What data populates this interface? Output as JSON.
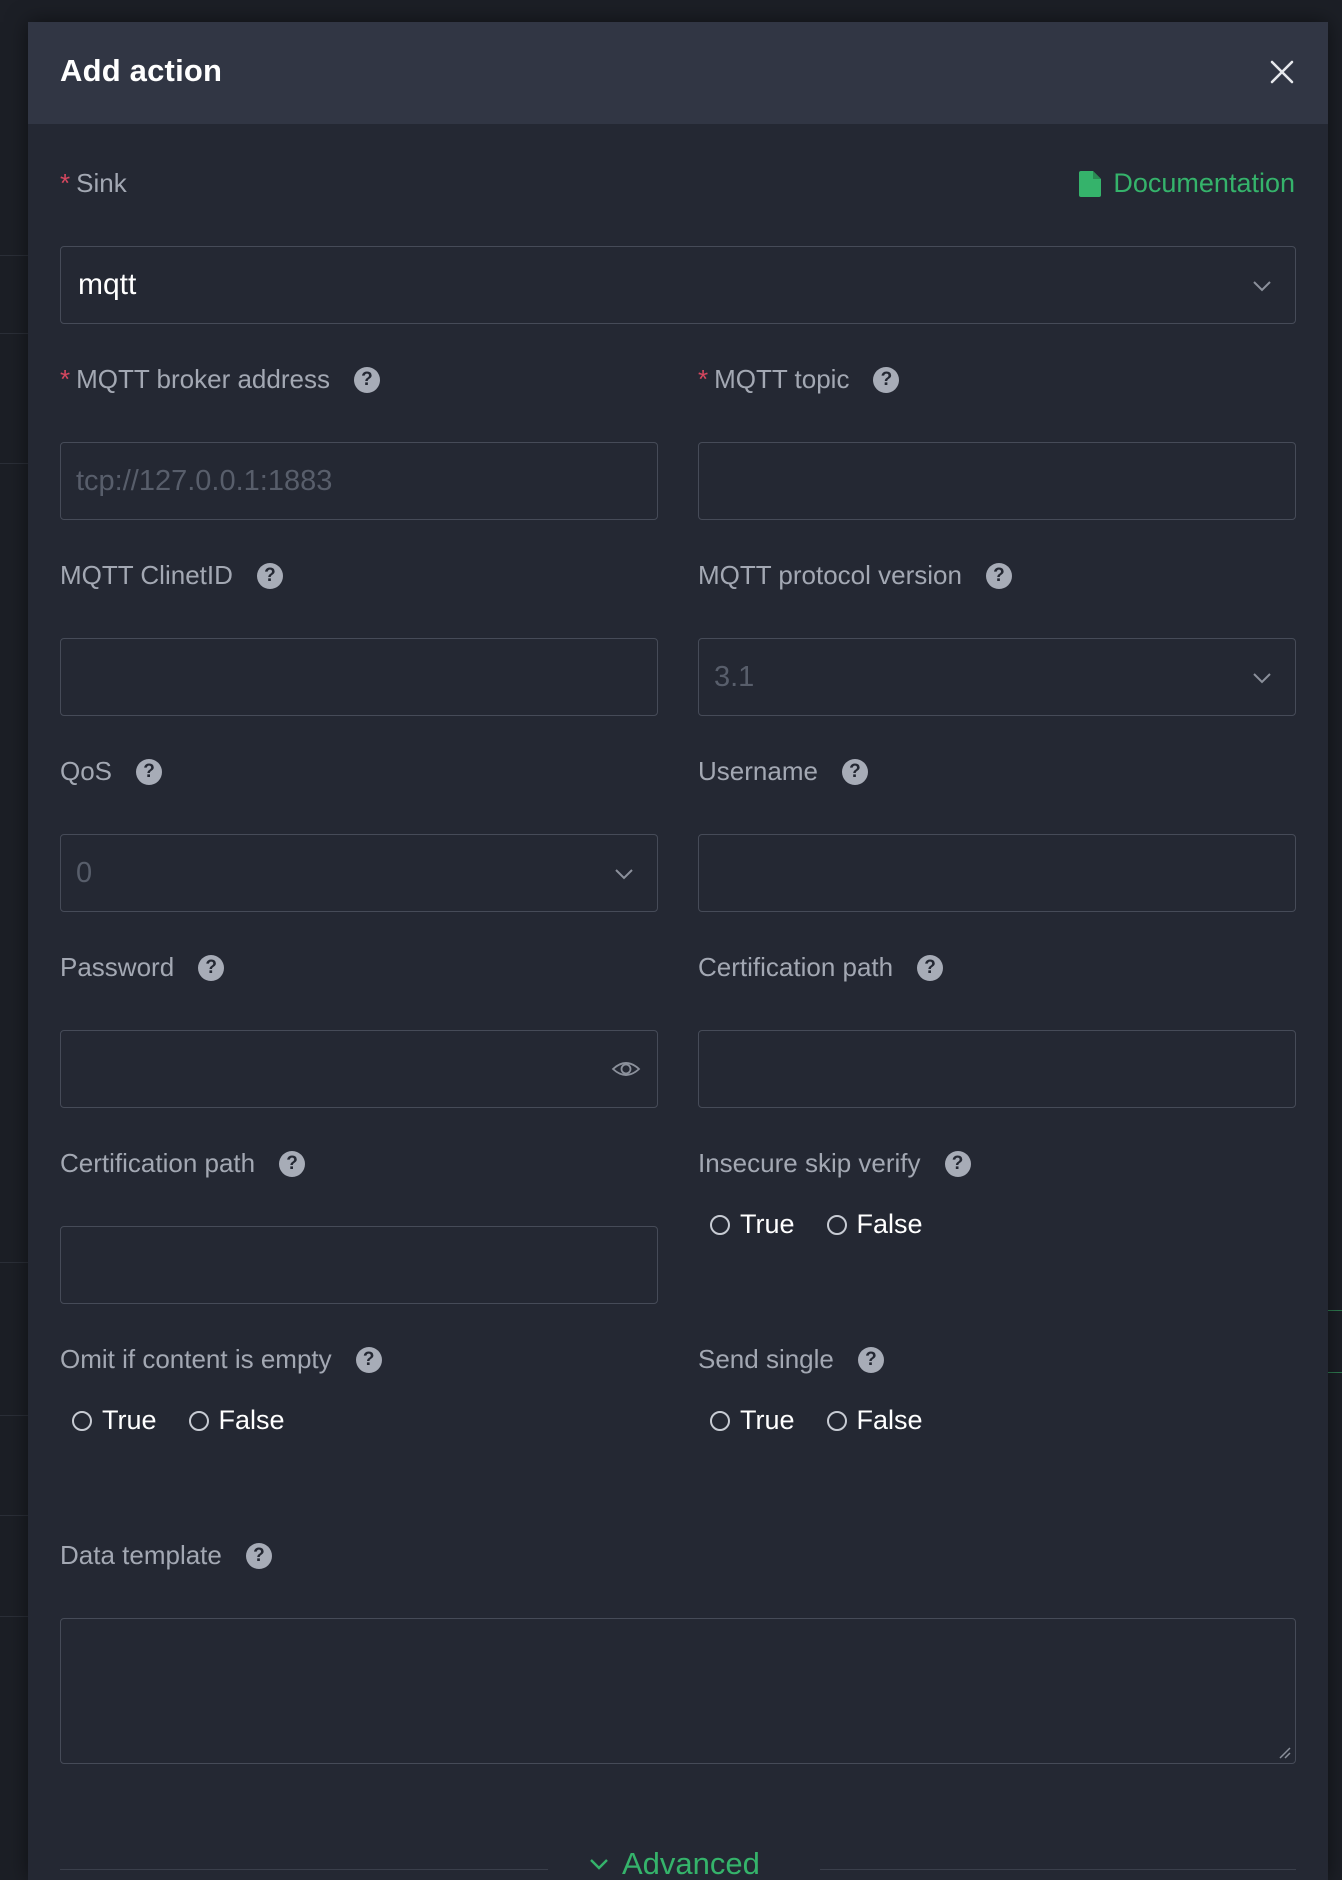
{
  "dialog": {
    "title": "Add action",
    "close_icon": "close-icon"
  },
  "doc_link": {
    "label": "Documentation",
    "icon": "document-icon",
    "color": "#35b36b"
  },
  "fields": {
    "sink": {
      "label": "Sink",
      "required": true,
      "value": "mqtt"
    },
    "broker": {
      "label": "MQTT broker address",
      "required": true,
      "placeholder": "tcp://127.0.0.1:1883"
    },
    "topic": {
      "label": "MQTT topic",
      "required": true,
      "value": ""
    },
    "client_id": {
      "label": "MQTT ClinetID",
      "value": ""
    },
    "protocol": {
      "label": "MQTT protocol version",
      "placeholder": "3.1"
    },
    "qos": {
      "label": "QoS",
      "placeholder": "0"
    },
    "username": {
      "label": "Username",
      "value": ""
    },
    "password": {
      "label": "Password",
      "value": ""
    },
    "cert_path_1": {
      "label": "Certification path",
      "value": ""
    },
    "cert_path_2": {
      "label": "Certification path",
      "value": ""
    },
    "insecure": {
      "label": "Insecure skip verify",
      "options": [
        "True",
        "False"
      ]
    },
    "omit_empty": {
      "label": "Omit if content is empty",
      "options": [
        "True",
        "False"
      ]
    },
    "send_single": {
      "label": "Send single",
      "options": [
        "True",
        "False"
      ]
    },
    "data_template": {
      "label": "Data template",
      "value": ""
    }
  },
  "advanced": {
    "label": "Advanced",
    "icon": "chevron-down-icon"
  },
  "help_glyph": "?",
  "required_mark": "*",
  "colors": {
    "accent": "#35b36b",
    "required": "#d6475f",
    "dialog_bg": "#242833",
    "header_bg": "#313644"
  }
}
